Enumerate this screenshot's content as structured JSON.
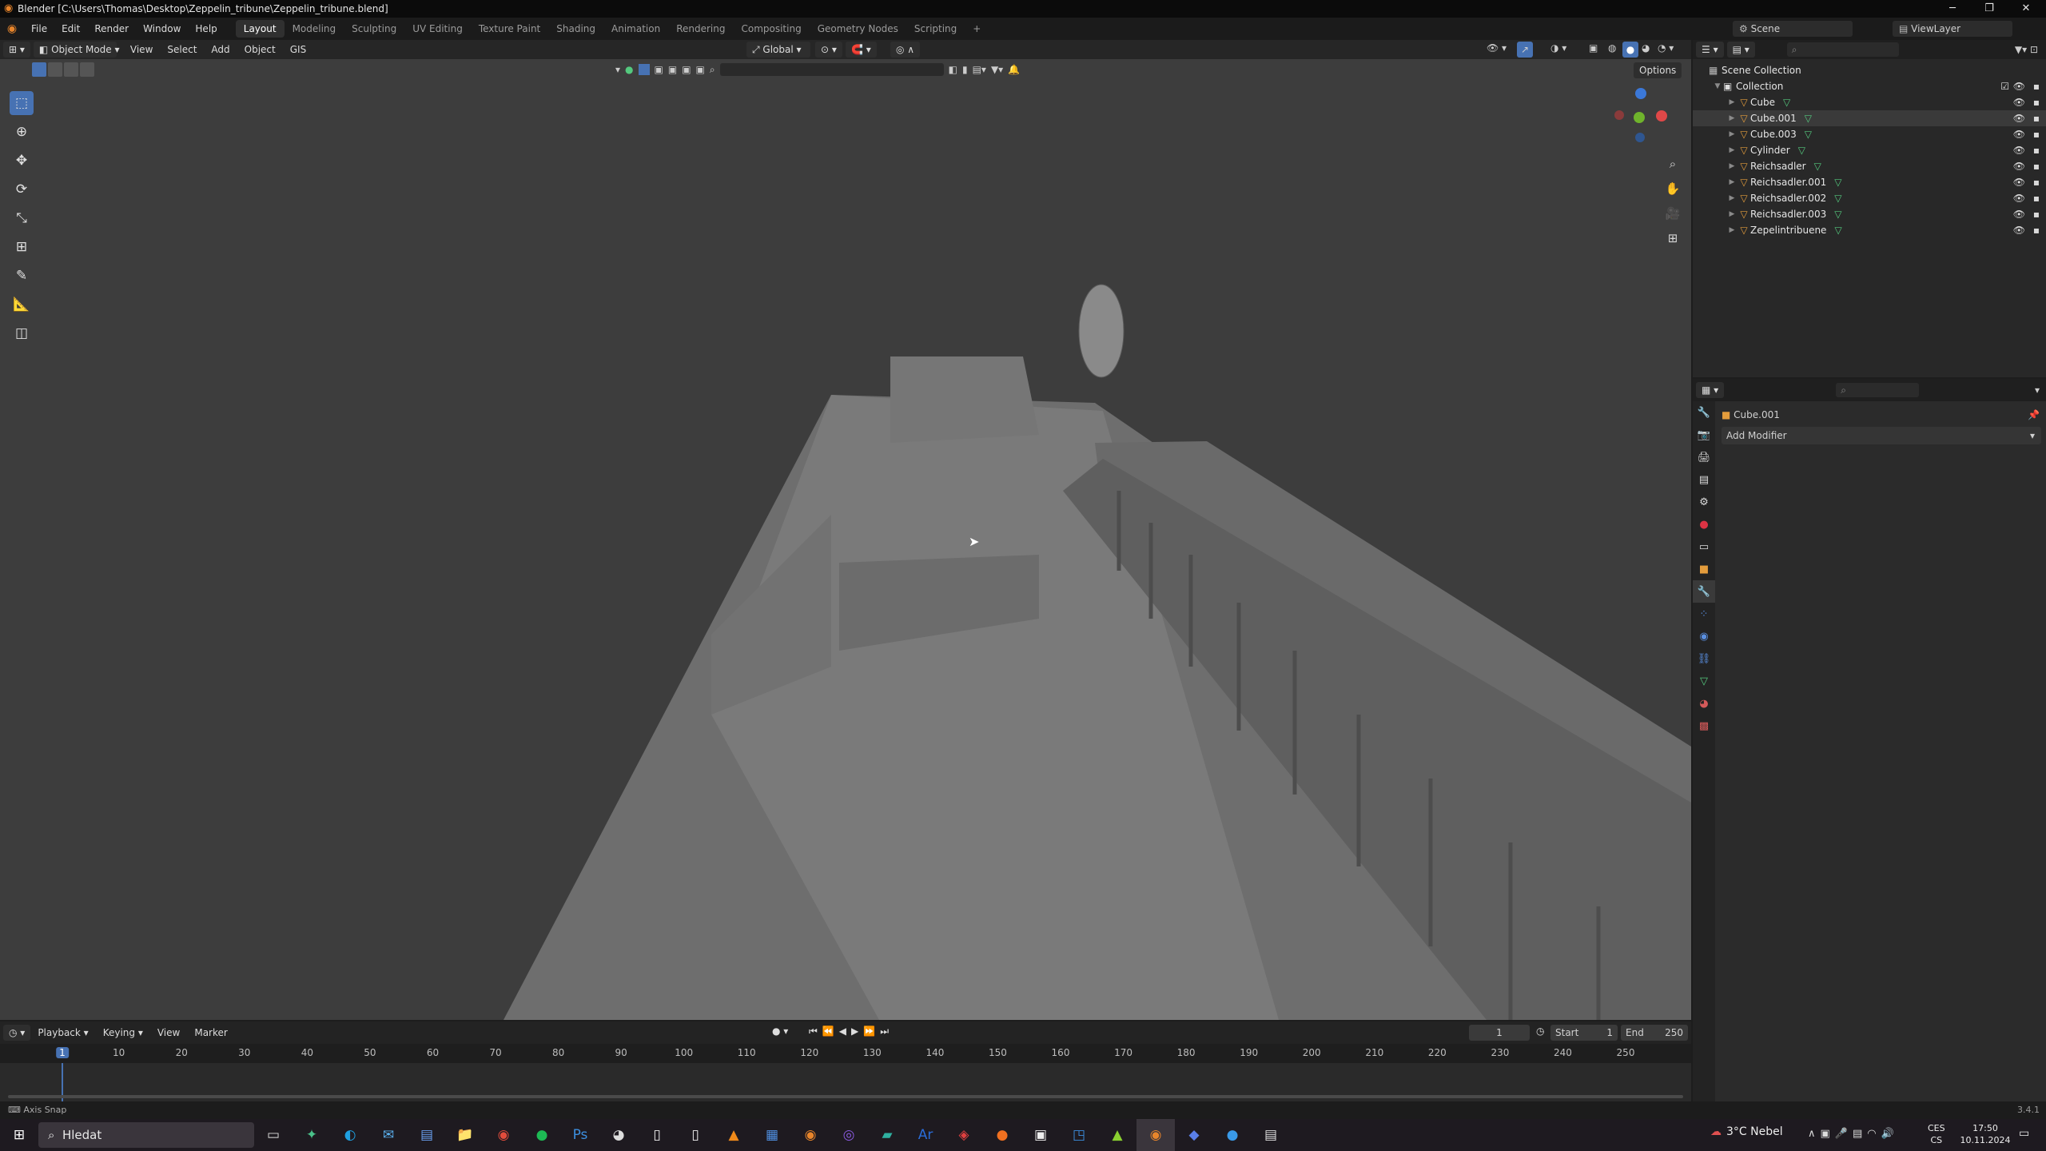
{
  "window": {
    "title": "Blender [C:\\Users\\Thomas\\Desktop\\Zeppelin_tribune\\Zeppelin_tribune.blend]"
  },
  "menu": [
    "File",
    "Edit",
    "Render",
    "Window",
    "Help"
  ],
  "workspaces": [
    "Layout",
    "Modeling",
    "Sculpting",
    "UV Editing",
    "Texture Paint",
    "Shading",
    "Animation",
    "Rendering",
    "Compositing",
    "Geometry Nodes",
    "Scripting"
  ],
  "active_workspace": "Layout",
  "scene": {
    "name": "Scene",
    "view_layer": "ViewLayer"
  },
  "viewport_header": {
    "mode": "Object Mode",
    "menus": [
      "View",
      "Select",
      "Add",
      "Object",
      "GIS"
    ],
    "transform_orientation": "Global",
    "options": "Options"
  },
  "outliner": {
    "root": "Scene Collection",
    "collection": "Collection",
    "items": [
      {
        "name": "Cube",
        "selected": false
      },
      {
        "name": "Cube.001",
        "selected": true
      },
      {
        "name": "Cube.003",
        "selected": false
      },
      {
        "name": "Cylinder",
        "selected": false
      },
      {
        "name": "Reichsadler",
        "selected": false
      },
      {
        "name": "Reichsadler.001",
        "selected": false
      },
      {
        "name": "Reichsadler.002",
        "selected": false
      },
      {
        "name": "Reichsadler.003",
        "selected": false
      },
      {
        "name": "Zepelintribuene",
        "selected": false
      }
    ]
  },
  "properties": {
    "object": "Cube.001",
    "add_modifier": "Add Modifier"
  },
  "timeline": {
    "menus": [
      "Playback",
      "Keying",
      "View",
      "Marker"
    ],
    "current_frame": "1",
    "start_label": "Start",
    "start": "1",
    "end_label": "End",
    "end": "250",
    "ticks": [
      "1",
      "10",
      "20",
      "30",
      "40",
      "50",
      "60",
      "70",
      "80",
      "90",
      "100",
      "110",
      "120",
      "130",
      "140",
      "150",
      "160",
      "170",
      "180",
      "190",
      "200",
      "210",
      "220",
      "230",
      "240",
      "250"
    ]
  },
  "status": {
    "left": "Axis Snap",
    "version": "3.4.1"
  },
  "taskbar": {
    "search_placeholder": "Hledat",
    "weather": "3°C  Nebel",
    "lang": "CES",
    "lang2": "CS",
    "time": "17:50",
    "date": "10.11.2024"
  },
  "colors": {
    "accent": "#4772b3",
    "object_orange": "#e39c3c",
    "mesh_green": "#54c97e",
    "viewport_bg": "#3d3d3d"
  }
}
